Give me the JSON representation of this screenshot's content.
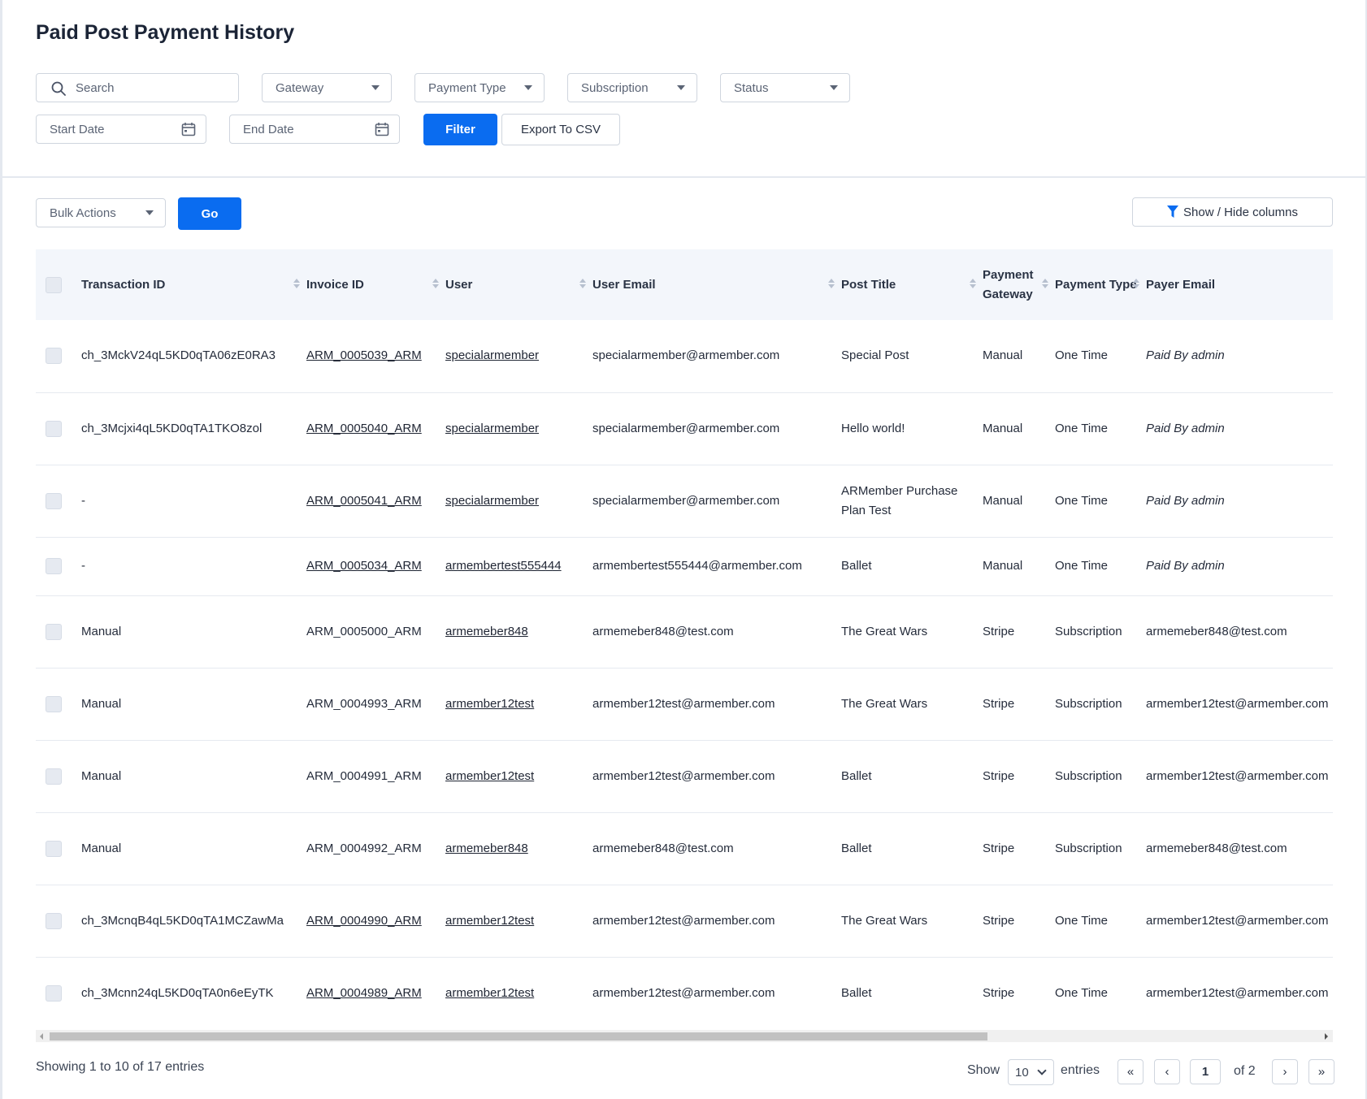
{
  "page": {
    "title": "Paid Post Payment History"
  },
  "filters": {
    "search_placeholder": "Search",
    "gateway": "Gateway",
    "payment_type": "Payment Type",
    "subscription": "Subscription",
    "status": "Status",
    "start_date": "Start Date",
    "end_date": "End Date",
    "filter_button": "Filter",
    "export_button": "Export To CSV"
  },
  "toolbar": {
    "bulk_actions": "Bulk Actions",
    "go_button": "Go",
    "show_hide_columns": "Show / Hide columns"
  },
  "table": {
    "columns": [
      "Transaction ID",
      "Invoice ID",
      "User",
      "User Email",
      "Post Title",
      "Payment Gateway",
      "Payment Type",
      "Payer Email"
    ],
    "rows": [
      {
        "transaction_id": "ch_3MckV24qL5KD0qTA06zE0RA3",
        "invoice_id": "ARM_0005039_ARM",
        "user": "specialarmember",
        "user_email": "specialarmember@armember.com",
        "post_title": "Special Post",
        "gateway": "Manual",
        "payment_type": "One Time",
        "payer_email": "Paid By admin"
      },
      {
        "transaction_id": "ch_3Mcjxi4qL5KD0qTA1TKO8zol",
        "invoice_id": "ARM_0005040_ARM",
        "user": "specialarmember",
        "user_email": "specialarmember@armember.com",
        "post_title": "Hello world!",
        "gateway": "Manual",
        "payment_type": "One Time",
        "payer_email": "Paid By admin"
      },
      {
        "transaction_id": "-",
        "invoice_id": "ARM_0005041_ARM",
        "user": "specialarmember",
        "user_email": "specialarmember@armember.com",
        "post_title": "ARMember Purchase Plan Test",
        "gateway": "Manual",
        "payment_type": "One Time",
        "payer_email": "Paid By admin"
      },
      {
        "transaction_id": "-",
        "invoice_id": "ARM_0005034_ARM",
        "user": "armembertest555444",
        "user_email": "armembertest555444@armember.com",
        "post_title": "Ballet",
        "gateway": "Manual",
        "payment_type": "One Time",
        "payer_email": "Paid By admin"
      },
      {
        "transaction_id": "Manual",
        "invoice_id": "ARM_0005000_ARM",
        "user": "armemeber848",
        "user_email": "armemeber848@test.com",
        "post_title": "The Great Wars",
        "gateway": "Stripe",
        "payment_type": "Subscription",
        "payer_email": "armemeber848@test.com"
      },
      {
        "transaction_id": "Manual",
        "invoice_id": "ARM_0004993_ARM",
        "user": "armember12test",
        "user_email": "armember12test@armember.com",
        "post_title": "The Great Wars",
        "gateway": "Stripe",
        "payment_type": "Subscription",
        "payer_email": "armember12test@armember.com"
      },
      {
        "transaction_id": "Manual",
        "invoice_id": "ARM_0004991_ARM",
        "user": "armember12test",
        "user_email": "armember12test@armember.com",
        "post_title": "Ballet",
        "gateway": "Stripe",
        "payment_type": "Subscription",
        "payer_email": "armember12test@armember.com"
      },
      {
        "transaction_id": "Manual",
        "invoice_id": "ARM_0004992_ARM",
        "user": "armemeber848",
        "user_email": "armemeber848@test.com",
        "post_title": "Ballet",
        "gateway": "Stripe",
        "payment_type": "Subscription",
        "payer_email": "armemeber848@test.com"
      },
      {
        "transaction_id": "ch_3McnqB4qL5KD0qTA1MCZawMa",
        "invoice_id": "ARM_0004990_ARM",
        "user": "armember12test",
        "user_email": "armember12test@armember.com",
        "post_title": "The Great Wars",
        "gateway": "Stripe",
        "payment_type": "One Time",
        "payer_email": "armember12test@armember.com"
      },
      {
        "transaction_id": "ch_3Mcnn24qL5KD0qTA0n6eEyTK",
        "invoice_id": "ARM_0004989_ARM",
        "user": "armember12test",
        "user_email": "armember12test@armember.com",
        "post_title": "Ballet",
        "gateway": "Stripe",
        "payment_type": "One Time",
        "payer_email": "armember12test@armember.com"
      }
    ]
  },
  "footer": {
    "showing": "Showing 1 to 10 of 17 entries",
    "show_label": "Show",
    "entries_label": "entries",
    "page_length": "10",
    "current_page": "1",
    "of_pages": "of 2",
    "first": "«",
    "prev": "‹",
    "next": "›",
    "last": "»"
  },
  "colors": {
    "primary": "#0a6cf0",
    "header_bg": "#f3f6fb",
    "border": "#cfd5de"
  }
}
